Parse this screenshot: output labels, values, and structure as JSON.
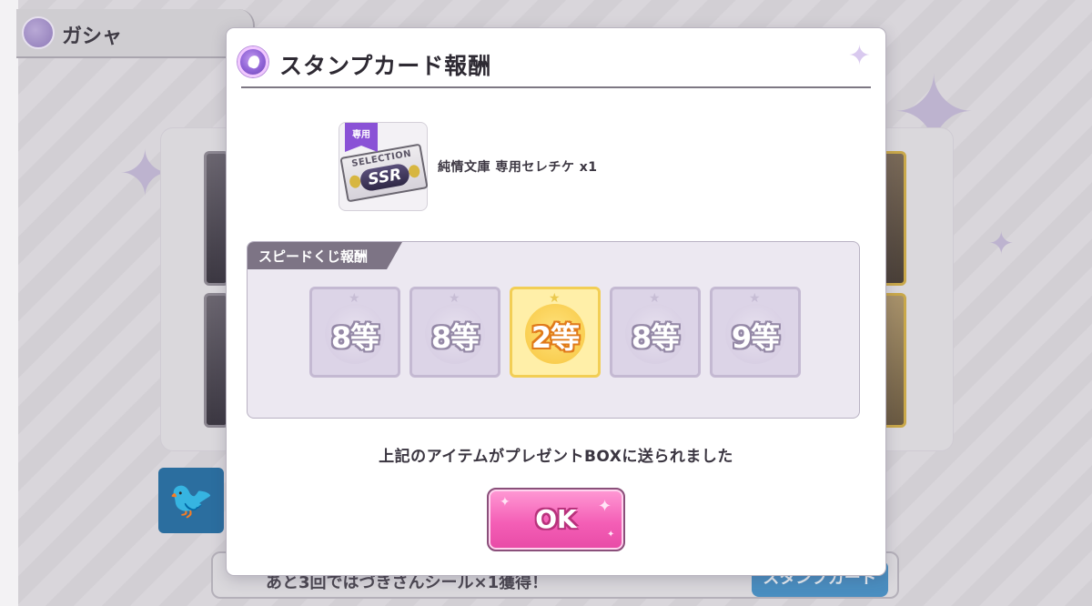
{
  "background": {
    "header_title": "ガシャ",
    "bottom_text": "あと3回ではづきさんシール×1獲得！",
    "stamp_button_label": "スタンプカード",
    "twitter_icon": "twitter-bird-icon"
  },
  "modal": {
    "title": "スタンプカード報酬",
    "title_icon": "gacha-emblem-icon",
    "corner_icon": "sparkle-icon",
    "reward": {
      "name": "純情文庫 専用セレチケ x1",
      "badge": "専用",
      "ticket_text_top": "SELECTION",
      "ticket_text_main": "SSR"
    },
    "lottery": {
      "tab_label": "スピードくじ報酬",
      "prizes": [
        {
          "rank": "8等",
          "winner": false
        },
        {
          "rank": "8等",
          "winner": false
        },
        {
          "rank": "2等",
          "winner": true
        },
        {
          "rank": "8等",
          "winner": false
        },
        {
          "rank": "9等",
          "winner": false
        }
      ]
    },
    "message": "上記のアイテムがプレゼントBOXに送られました",
    "ok_label": "OK"
  },
  "colors": {
    "accent_pink": "#f45fb6",
    "winner_gold": "#f7c640",
    "tab_gray": "#7d7485"
  }
}
